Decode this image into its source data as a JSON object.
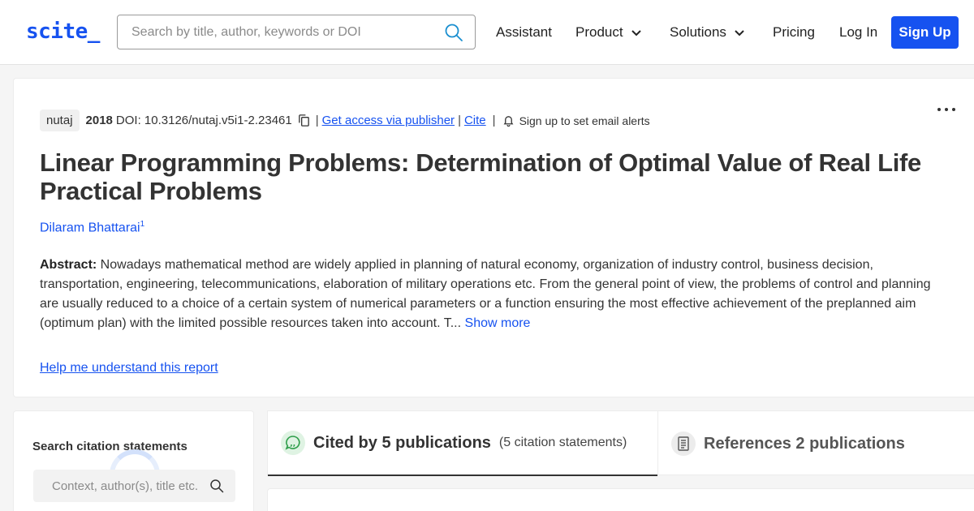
{
  "header": {
    "logo": "scite_",
    "search_placeholder": "Search by title, author, keywords or DOI",
    "nav": {
      "assistant": "Assistant",
      "product": "Product",
      "solutions": "Solutions",
      "pricing": "Pricing",
      "login": "Log In",
      "signup": "Sign Up"
    }
  },
  "paper": {
    "journal": "nutaj",
    "year": "2018",
    "doi": "DOI: 10.3126/nutaj.v5i1-2.23461",
    "access_link": "Get access via publisher",
    "cite_link": "Cite",
    "alerts": "Sign up to set email alerts",
    "title": "Linear Programming Problems: Determination of Optimal Value of Real Life Practical Problems",
    "author": "Dilaram Bhattarai",
    "author_sup": "1",
    "abstract_label": "Abstract:",
    "abstract_text": " Nowadays mathematical method are widely applied in planning of natural economy, organization of industry control, business decision, transportation, engineering, telecommunications, elaboration of military operations etc. From the general point of view, the problems of control and planning are usually reduced to a choice of a certain system of numerical parameters or a function ensuring the most effective achievement of the preplanned aim (optimum plan) with the limited possible resources taken into account. T...",
    "show_more": "Show more",
    "help_link": "Help me understand this report"
  },
  "citations": {
    "search_title": "Search citation statements",
    "search_placeholder": "Context, author(s), title etc."
  },
  "tabs": {
    "cited_label": "Cited by 5 publications",
    "cited_sub": "(5 citation statements)",
    "refs_label": "References 2 publications"
  },
  "colors": {
    "brand": "#1652f0",
    "cited_icon_bg": "#dff3e3",
    "cited_icon": "#2e9e4a"
  }
}
